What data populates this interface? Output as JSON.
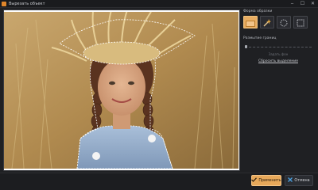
{
  "window": {
    "title": "Вырезать объект",
    "buttons": [
      "‒",
      "☐",
      "✕"
    ]
  },
  "sidebar": {
    "shape_label": "Форма образки",
    "shapes": [
      {
        "icon": "rectangle-icon",
        "active": true
      },
      {
        "icon": "magic-wand-icon",
        "active": false
      },
      {
        "icon": "ellipse-icon",
        "active": false
      },
      {
        "icon": "square-dashed-icon",
        "active": false
      }
    ],
    "brush_label": "Размытие границ",
    "brush_value": 0,
    "apply_link": "Задать фон",
    "reset_link": "Сбросить выделение"
  },
  "footer": {
    "apply_label": "Применить",
    "cancel_label": "Отмена"
  },
  "colors": {
    "accent": "#e7a85a",
    "background": "#1f2023"
  }
}
